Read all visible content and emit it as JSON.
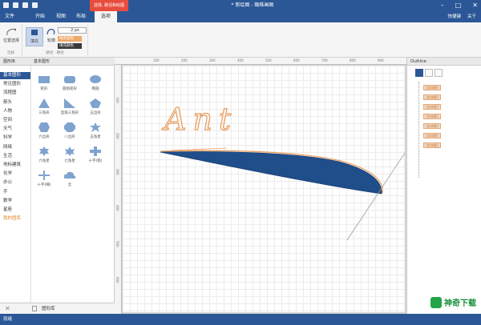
{
  "titlebar": {
    "contextual_tab": "选择, 路径和绘图",
    "title": "* 新绘图 - 蜘蛛画图",
    "controls": [
      "–",
      "□",
      "✕"
    ]
  },
  "menu": {
    "items": [
      "文件",
      "开始",
      "视图",
      "布局",
      "选项"
    ],
    "active": "选项",
    "right": [
      "快捷键",
      "关于"
    ]
  },
  "ribbon": {
    "group1": {
      "button": "位置选择",
      "caption": "选择"
    },
    "group2": {
      "buttons": [
        "填充",
        "轮廓"
      ],
      "spin_value": "2 px",
      "fill_label": "线条颜色",
      "fill2_label": "填充颜色",
      "caption": "路径 · 路径"
    }
  },
  "left_panel": {
    "header_left": "图形库",
    "header_right": "基本图形",
    "categories": [
      "基本图形",
      "常见图形",
      "流程图",
      "箭头",
      "人物",
      "空间",
      "天气",
      "科学",
      "网络",
      "生活",
      "地标建筑",
      "化学",
      "办公",
      "手",
      "数学",
      "星座",
      "我的图库"
    ],
    "shapes": [
      "矩形",
      "圆角矩形",
      "椭圆",
      "三角形",
      "直角三角形",
      "五边形",
      "六边形",
      "八边形",
      "五角星",
      "六角星",
      "七角星",
      "十字(粗)",
      "十字(细)",
      "云"
    ],
    "bottom_label": "图形库"
  },
  "canvas": {
    "handwriting": "Ant",
    "ruler_top": [
      "100",
      "200",
      "300",
      "400",
      "500",
      "600",
      "700",
      "800",
      "900"
    ],
    "ruler_left": [
      "100",
      "200",
      "300",
      "400",
      "500",
      "600"
    ]
  },
  "outline": {
    "title": "Outline",
    "items": [
      "[文本框]",
      "[文本框]",
      "[文本框]",
      "[文本框]",
      "[文本框]",
      "[文本框]",
      "[文本框]"
    ]
  },
  "status": {
    "text": "就绪"
  },
  "watermark": {
    "text": "神奇下载"
  },
  "colors": {
    "accent": "#2b5797",
    "context": "#e84c3d",
    "fill": "#1f4e8a",
    "stroke": "#f0a868"
  }
}
